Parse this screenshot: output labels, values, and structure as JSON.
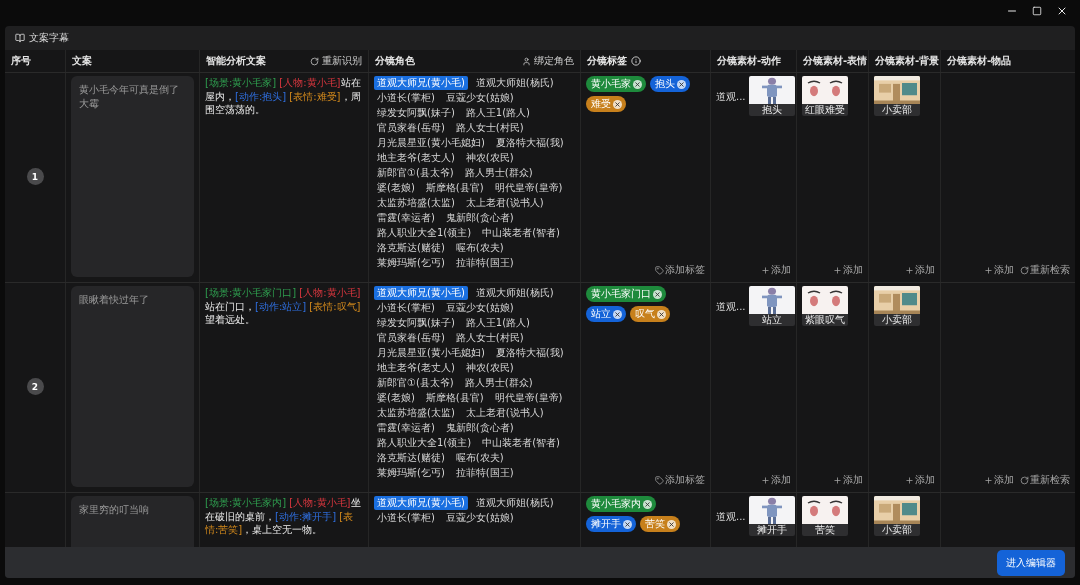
{
  "panel": {
    "title": "文案字幕"
  },
  "table": {
    "columns": [
      {
        "label": "序号"
      },
      {
        "label": "文案"
      },
      {
        "label": "智能分析文案",
        "action": "重新识别"
      },
      {
        "label": "分镜角色",
        "action": "绑定角色"
      },
      {
        "label": "分镜标签",
        "info": true
      },
      {
        "label": "分镜素材-动作"
      },
      {
        "label": "分镜素材-表情"
      },
      {
        "label": "分镜素材-背景"
      },
      {
        "label": "分镜素材-物品"
      }
    ],
    "rows": [
      {
        "number": "1",
        "script": "黄小毛今年可真是倒了大霉",
        "analysis": [
          {
            "kind": "scene",
            "text": "[场景:黄小毛家]"
          },
          {
            "kind": "person",
            "text": " [人物:黄小毛]"
          },
          {
            "kind": "plain",
            "text": "站在屋内，"
          },
          {
            "kind": "action",
            "text": "[动作:抱头]"
          },
          {
            "kind": "expression",
            "text": " [表情:难受]"
          },
          {
            "kind": "plain",
            "text": "，周围空荡荡的。"
          }
        ],
        "roles": [
          {
            "name": "道观大师兄(黄小毛)",
            "selected": true
          },
          {
            "name": "道观大师姐(杨氏)",
            "selected": false
          },
          {
            "name": "小道长(掌柜)",
            "selected": false
          },
          {
            "name": "豆蔻少女(姑娘)",
            "selected": false
          },
          {
            "name": "绿发女阿飘(妹子)",
            "selected": false
          },
          {
            "name": "路人王1(路人)",
            "selected": false
          },
          {
            "name": "官员家眷(岳母)",
            "selected": false
          },
          {
            "name": "路人女士(村民)",
            "selected": false
          },
          {
            "name": "月光晨星亚(黄小毛媳妇)",
            "selected": false
          },
          {
            "name": "夏洛特大福(我)",
            "selected": false
          },
          {
            "name": "地主老爷(老丈人)",
            "selected": false
          },
          {
            "name": "神农(农民)",
            "selected": false
          },
          {
            "name": "新郎官①(县太爷)",
            "selected": false
          },
          {
            "name": "路人男士(群众)",
            "selected": false
          },
          {
            "name": "婆(老娘)",
            "selected": false
          },
          {
            "name": "斯摩格(县官)",
            "selected": false
          },
          {
            "name": "明代皇帝(皇帝)",
            "selected": false
          },
          {
            "name": "太监苏培盛(太监)",
            "selected": false
          },
          {
            "name": "太上老君(说书人)",
            "selected": false
          },
          {
            "name": "雷霆(幸运者)",
            "selected": false
          },
          {
            "name": "鬼新郎(贪心者)",
            "selected": false
          },
          {
            "name": "路人职业大全1(领主)",
            "selected": false
          },
          {
            "name": "中山装老者(智者)",
            "selected": false
          },
          {
            "name": "洛克斯达(赌徒)",
            "selected": false
          },
          {
            "name": "喔布(农夫)",
            "selected": false
          },
          {
            "name": "莱姆玛斯(乞丐)",
            "selected": false
          },
          {
            "name": "拉菲特(国王)",
            "selected": false
          }
        ],
        "tags": [
          {
            "label": "黄小毛家",
            "color": "#1e8a3c"
          },
          {
            "label": "抱头",
            "color": "#1463d8"
          },
          {
            "label": "难受",
            "color": "#c7801c"
          }
        ],
        "action": {
          "name": "道观...",
          "material": "抱头"
        },
        "expression": {
          "material": "红眼难受"
        },
        "background": {
          "material": "小卖部"
        },
        "footer": {
          "tags": "添加标签",
          "action": "添加",
          "expression": "添加",
          "background": "添加",
          "items": "添加",
          "research": "重新检索"
        }
      },
      {
        "number": "2",
        "script": "眼瞅着快过年了",
        "analysis": [
          {
            "kind": "scene",
            "text": "[场景:黄小毛家门口]"
          },
          {
            "kind": "person",
            "text": " [人物:黄小毛]"
          },
          {
            "kind": "plain",
            "text": "站在门口，"
          },
          {
            "kind": "action",
            "text": "[动作:站立]"
          },
          {
            "kind": "expression",
            "text": " [表情:叹气]"
          },
          {
            "kind": "plain",
            "text": "望着远处。"
          }
        ],
        "roles": [
          {
            "name": "道观大师兄(黄小毛)",
            "selected": true
          },
          {
            "name": "道观大师姐(杨氏)",
            "selected": false
          },
          {
            "name": "小道长(掌柜)",
            "selected": false
          },
          {
            "name": "豆蔻少女(姑娘)",
            "selected": false
          },
          {
            "name": "绿发女阿飘(妹子)",
            "selected": false
          },
          {
            "name": "路人王1(路人)",
            "selected": false
          },
          {
            "name": "官员家眷(岳母)",
            "selected": false
          },
          {
            "name": "路人女士(村民)",
            "selected": false
          },
          {
            "name": "月光晨星亚(黄小毛媳妇)",
            "selected": false
          },
          {
            "name": "夏洛特大福(我)",
            "selected": false
          },
          {
            "name": "地主老爷(老丈人)",
            "selected": false
          },
          {
            "name": "神农(农民)",
            "selected": false
          },
          {
            "name": "新郎官①(县太爷)",
            "selected": false
          },
          {
            "name": "路人男士(群众)",
            "selected": false
          },
          {
            "name": "婆(老娘)",
            "selected": false
          },
          {
            "name": "斯摩格(县官)",
            "selected": false
          },
          {
            "name": "明代皇帝(皇帝)",
            "selected": false
          },
          {
            "name": "太监苏培盛(太监)",
            "selected": false
          },
          {
            "name": "太上老君(说书人)",
            "selected": false
          },
          {
            "name": "雷霆(幸运者)",
            "selected": false
          },
          {
            "name": "鬼新郎(贪心者)",
            "selected": false
          },
          {
            "name": "路人职业大全1(领主)",
            "selected": false
          },
          {
            "name": "中山装老者(智者)",
            "selected": false
          },
          {
            "name": "洛克斯达(赌徒)",
            "selected": false
          },
          {
            "name": "喔布(农夫)",
            "selected": false
          },
          {
            "name": "莱姆玛斯(乞丐)",
            "selected": false
          },
          {
            "name": "拉菲特(国王)",
            "selected": false
          }
        ],
        "tags": [
          {
            "label": "黄小毛家门口",
            "color": "#1e8a3c"
          },
          {
            "label": "站立",
            "color": "#1463d8"
          },
          {
            "label": "叹气",
            "color": "#c7801c"
          }
        ],
        "action": {
          "name": "道观...",
          "material": "站立"
        },
        "expression": {
          "material": "紫眼叹气"
        },
        "background": {
          "material": "小卖部"
        },
        "footer": {
          "tags": "添加标签",
          "action": "添加",
          "expression": "添加",
          "background": "添加",
          "items": "添加",
          "research": "重新检索"
        }
      },
      {
        "script": "家里穷的叮当响",
        "analysis": [
          {
            "kind": "scene",
            "text": "[场景:黄小毛家内]"
          },
          {
            "kind": "person",
            "text": " [人物:黄小毛]"
          },
          {
            "kind": "plain",
            "text": "坐在破旧的桌前，"
          },
          {
            "kind": "action",
            "text": "[动作:摊开手]"
          },
          {
            "kind": "expression",
            "text": " [表情:苦笑]"
          },
          {
            "kind": "plain",
            "text": "，桌上空无一物。"
          }
        ],
        "roles": [
          {
            "name": "道观大师兄(黄小毛)",
            "selected": true
          },
          {
            "name": "道观大师姐(杨氏)",
            "selected": false
          },
          {
            "name": "小道长(掌柜)",
            "selected": false
          },
          {
            "name": "豆蔻少女(姑娘)",
            "selected": false
          }
        ],
        "tags": [
          {
            "label": "黄小毛家内",
            "color": "#1e8a3c"
          },
          {
            "label": "摊开手",
            "color": "#1463d8"
          },
          {
            "label": "苦笑",
            "color": "#c7801c"
          }
        ],
        "action": {
          "name": "道观...",
          "material": "摊开手"
        },
        "expression": {
          "material": "苦笑"
        },
        "background": {
          "material": "小卖部"
        }
      }
    ]
  },
  "footer": {
    "button": "进入编辑器"
  }
}
